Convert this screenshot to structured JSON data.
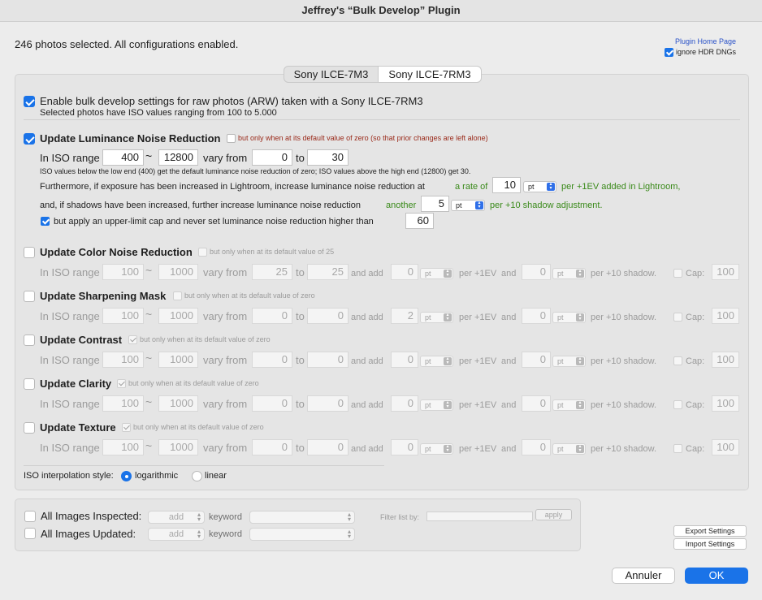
{
  "window": {
    "title": "Jeffrey's “Bulk Develop” Plugin"
  },
  "header": {
    "status": "246 photos selected. All configurations enabled.",
    "home_link": "Plugin Home Page",
    "ignore_hdr": {
      "label": "ignore HDR DNGs",
      "checked": true
    }
  },
  "tabs": [
    {
      "label": "Sony ILCE-7M3",
      "selected": false
    },
    {
      "label": "Sony ILCE-7RM3",
      "selected": true
    }
  ],
  "camera": {
    "enable_label": "Enable bulk develop settings for raw photos (ARW) taken with a Sony ILCE-7RM3",
    "iso_summary": "Selected photos have ISO values ranging from 100 to 5.000"
  },
  "common": {
    "in_iso_range": "In ISO range",
    "tilde": "~",
    "vary_from": "vary from",
    "to": "to",
    "and_add": "and add",
    "per_1ev": "per +1EV",
    "and": "and",
    "per_10_shadow": "per +10 shadow.",
    "cap": "Cap:",
    "pt": "pt"
  },
  "luminance": {
    "title": "Update Luminance Noise Reduction",
    "default_note": "but only when at its default value of zero (so that prior changes are left alone)",
    "iso_low": "400",
    "iso_high": "12800",
    "vary_from": "0",
    "vary_to": "30",
    "explain": "ISO values below the low end (400) get the default luminance noise reduction of zero; ISO values above the high end (12800) get 30.",
    "exposure_prefix": "Furthermore, if exposure has been increased in Lightroom, increase luminance noise reduction at",
    "rate_label": "a rate of",
    "rate_value": "10",
    "rate_suffix": "per +1EV added in Lightroom,",
    "shadow_prefix": "and, if shadows have been increased, further increase luminance noise reduction",
    "shadow_label": "another",
    "shadow_value": "5",
    "shadow_suffix": "per +10 shadow adjustment.",
    "cap_label": "but apply an upper-limit cap and never set luminance noise reduction higher than",
    "cap_value": "60"
  },
  "rows": [
    {
      "title": "Update Color Noise Reduction",
      "note": "but only when at its default value of 25",
      "iso_low": "100",
      "iso_high": "1000",
      "from": "25",
      "to": "25",
      "ev": "0",
      "shadow": "0",
      "cap": "100"
    },
    {
      "title": "Update Sharpening Mask",
      "note": "but only when at its default value of zero",
      "iso_low": "100",
      "iso_high": "1000",
      "from": "0",
      "to": "0",
      "ev": "2",
      "shadow": "0",
      "cap": "100"
    },
    {
      "title": "Update Contrast",
      "note": "but only when at its default value of zero",
      "iso_low": "100",
      "iso_high": "1000",
      "from": "0",
      "to": "0",
      "ev": "0",
      "shadow": "0",
      "cap": "100"
    },
    {
      "title": "Update Clarity",
      "note": "but only when at its default value of zero",
      "iso_low": "100",
      "iso_high": "1000",
      "from": "0",
      "to": "0",
      "ev": "0",
      "shadow": "0",
      "cap": "100"
    },
    {
      "title": "Update Texture",
      "note": "but only when at its default value of zero",
      "iso_low": "100",
      "iso_high": "1000",
      "from": "0",
      "to": "0",
      "ev": "0",
      "shadow": "0",
      "cap": "100"
    }
  ],
  "interpolation": {
    "label": "ISO interpolation style:",
    "options": [
      "logarithmic",
      "linear"
    ],
    "selected": "logarithmic"
  },
  "bottom": {
    "inspected_label": "All Images Inspected:",
    "updated_label": "All Images Updated:",
    "add": "add",
    "keyword": "keyword",
    "filter_label": "Filter list by:",
    "apply": "apply",
    "export": "Export Settings",
    "import": "Import Settings"
  },
  "footer": {
    "cancel": "Annuler",
    "ok": "OK"
  },
  "colors": {
    "accent": "#1a73e8",
    "note_red": "#9a2a1a",
    "note_green": "#3a8a1a",
    "link": "#2a52c8"
  }
}
